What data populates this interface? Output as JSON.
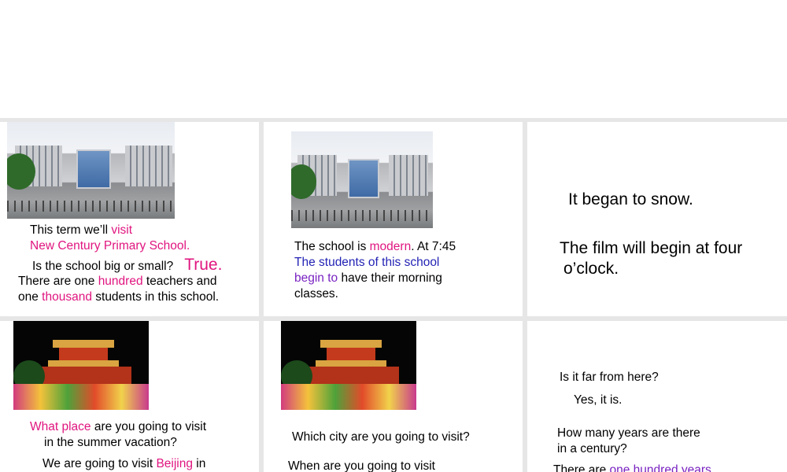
{
  "slides": {
    "s1": {
      "line1": "This term we’ll ",
      "line1_hl": "visit",
      "line2": "New Century Primary School.",
      "line3": "Is the school big or small?",
      "line3_hl": "True.",
      "line4_a": "There are one ",
      "line4_hl": "hundred",
      "line4_b": " teachers and",
      "line5_a": "one ",
      "line5_hl": "thousand",
      "line5_b": " students in this school."
    },
    "s2": {
      "line1_a": "The school is ",
      "line1_hl": "modern",
      "line1_b": ". At 7:45",
      "line2": "The students of this school",
      "line3_hl": "begin to",
      "line3_b": " have their morning",
      "line4": "classes."
    },
    "s3": {
      "line1": "It began to snow.",
      "line2": "The film will begin at four",
      "line3": "o’clock."
    },
    "s4": {
      "line1_hl": "What place",
      "line1_b": " are you going to visit",
      "line2": "in the summer vacation?",
      "line3_a": "We are going to visit ",
      "line3_hl": "Beijing",
      "line3_b": " in"
    },
    "s5": {
      "line1": "Which city are you going to visit?",
      "line2": "When are you going to visit"
    },
    "s6": {
      "line1": "Is it far from here?",
      "line2": "Yes, it is.",
      "line3": "How many years are there",
      "line4": "in a century?",
      "line5_a": "There are ",
      "line5_hl": "one hundred years"
    }
  },
  "colors": {
    "highlight_pink": "#e0157f",
    "highlight_blue": "#2323b5",
    "highlight_purple": "#7a23c2",
    "divider": "#e6e6e6"
  }
}
